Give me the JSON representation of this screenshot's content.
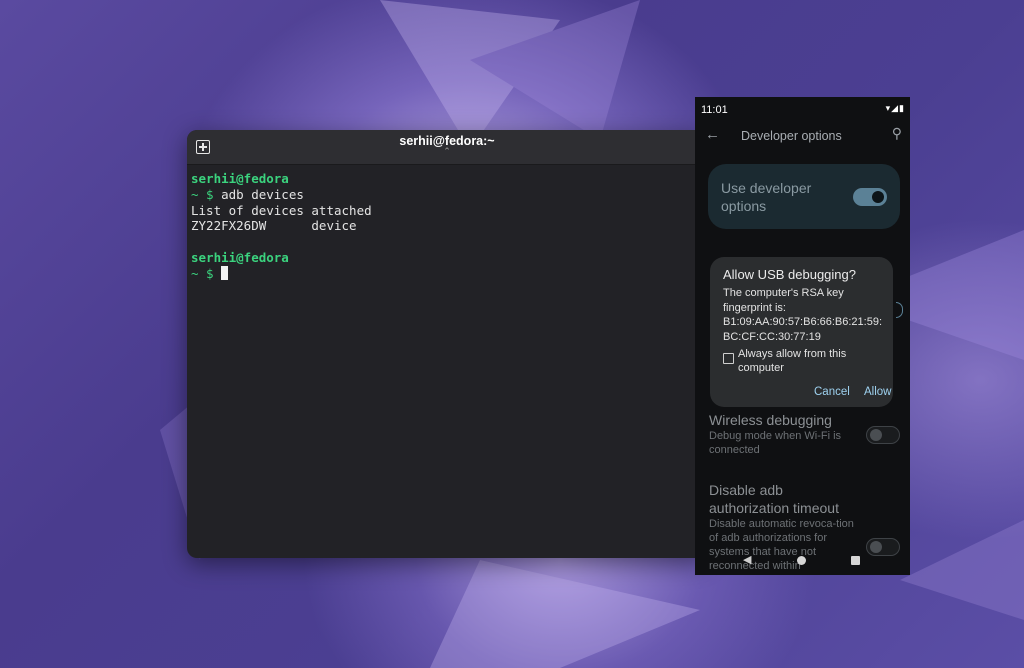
{
  "terminal": {
    "title": "serhii@fedora:~",
    "title_caret": "⌃",
    "lines": [
      {
        "user": "serhii@fedora",
        "prompt": "~ $",
        "command": " adb devices"
      },
      {
        "output": "List of devices attached"
      },
      {
        "output": "ZY22FX26DW      device"
      },
      {
        "blank": ""
      },
      {
        "user": "serhii@fedora",
        "prompt": "~ $"
      }
    ]
  },
  "phone": {
    "status": {
      "time": "11:01",
      "icons": "▾◢▮"
    },
    "app_bar": {
      "title": "Developer options",
      "back": "←",
      "search": "⚲"
    },
    "use_dev": {
      "label": "Use developer options"
    },
    "dialog": {
      "title": "Allow USB debugging?",
      "body": "The computer's RSA key fingerprint is:",
      "fingerprint": "B1:09:AA:90:57:B6:66:B6:21:59:BC:CF:CC:30:77:19",
      "checkbox_label": "Always allow from this computer",
      "cancel": "Cancel",
      "allow": "Allow"
    },
    "wireless": {
      "title": "Wireless debugging",
      "subtitle": "Debug mode when Wi-Fi is connected"
    },
    "adb_timeout": {
      "title": "Disable adb authorization timeout",
      "subtitle": "Disable automatic revoca-tion of adb authorizations for systems that have not reconnected within"
    },
    "nav": {
      "back": "◀"
    }
  }
}
